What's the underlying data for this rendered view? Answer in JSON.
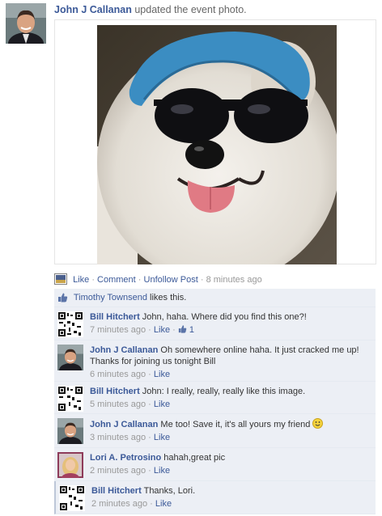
{
  "post": {
    "author": "John J Callanan",
    "action_text": "updated the event photo."
  },
  "actions": {
    "like": "Like",
    "comment": "Comment",
    "unfollow": "Unfollow Post",
    "time": "8 minutes ago",
    "separator": "·"
  },
  "likes": {
    "name": "Timothy Townsend",
    "text": "likes this."
  },
  "comments": [
    {
      "author": "Bill Hitchert",
      "text": "John, haha. Where did you find this one?!",
      "time": "7 minutes ago",
      "like": "Like",
      "like_count": "1",
      "avatar": "qr-avatar"
    },
    {
      "author": "John J Callanan",
      "text": "Oh somewhere online haha. It just cracked me up! Thanks for joining us tonight Bill",
      "time": "6 minutes ago",
      "like": "Like",
      "avatar": "john-avatar"
    },
    {
      "author": "Bill Hitchert",
      "text": "John: I really, really, really like this image.",
      "time": "5 minutes ago",
      "like": "Like",
      "avatar": "qr-avatar"
    },
    {
      "author": "John J Callanan",
      "text": "Me too! Save it, it's all yours my friend",
      "time": "3 minutes ago",
      "like": "Like",
      "avatar": "john-avatar",
      "emoji": "smiley"
    },
    {
      "author": "Lori A. Petrosino",
      "text": "hahah,great pic",
      "time": "2 minutes ago",
      "like": "Like",
      "avatar": "lori-avatar"
    },
    {
      "author": "Bill Hitchert",
      "text": "Thanks, Lori.",
      "time": "2 minutes ago",
      "like": "Like",
      "avatar": "qr-avatar"
    }
  ],
  "colors": {
    "link": "#3b5998",
    "comment_bg": "#eceff5",
    "meta": "#999999"
  }
}
